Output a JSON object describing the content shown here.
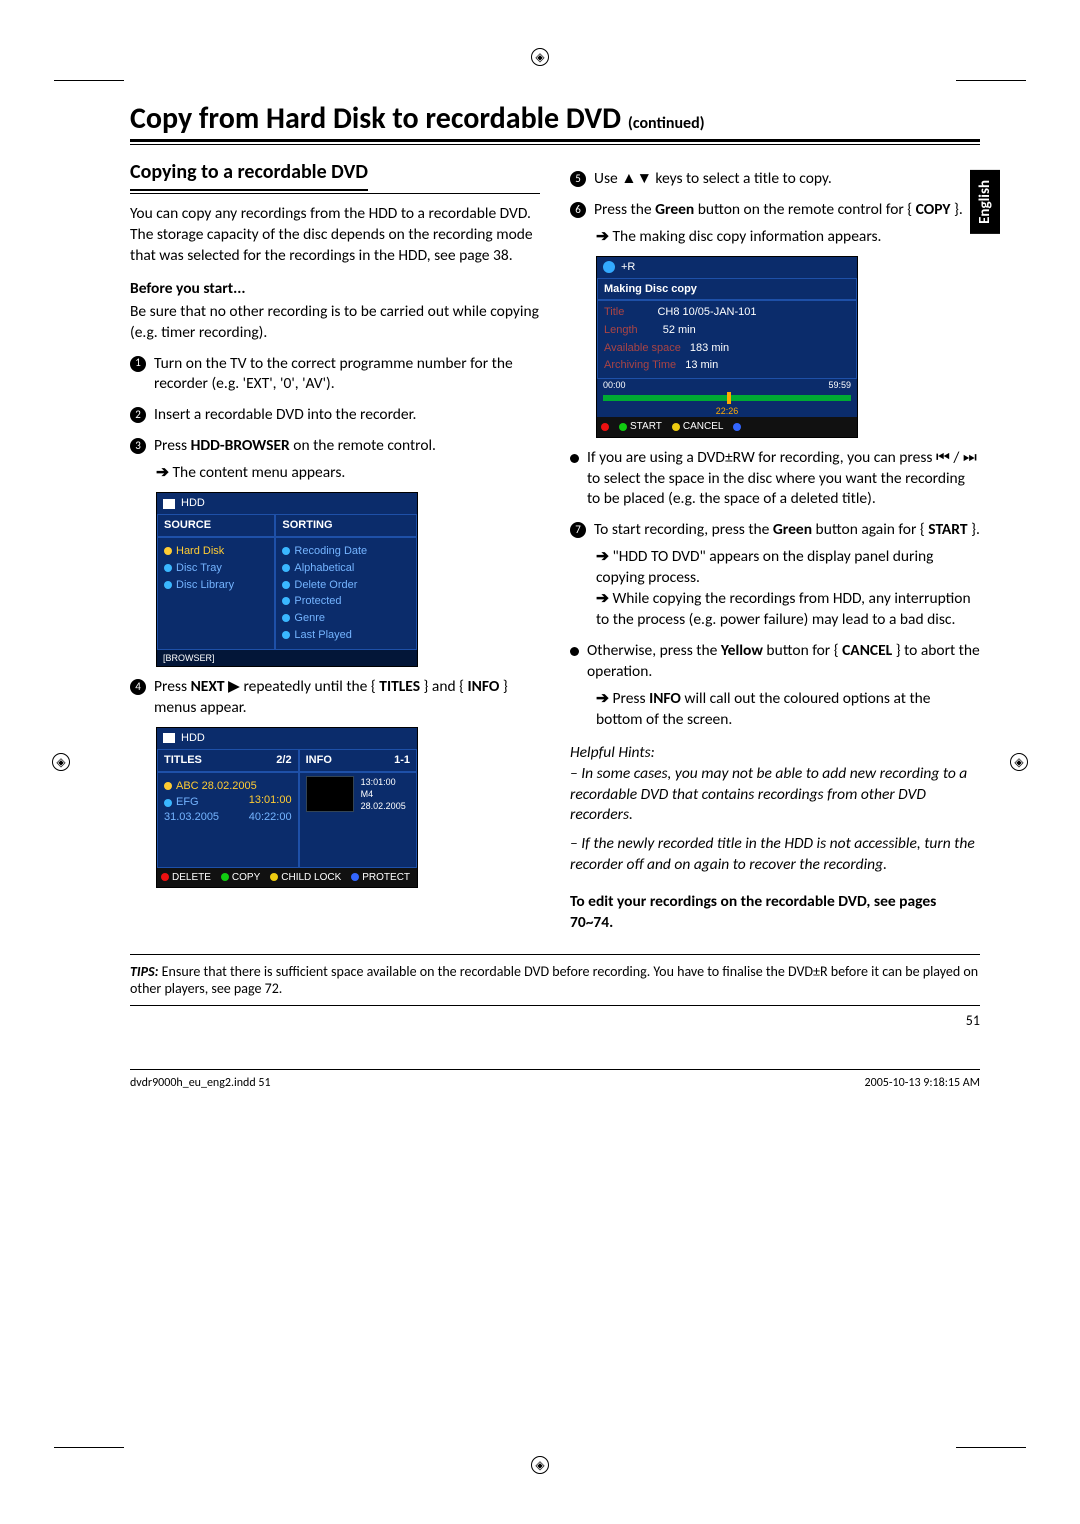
{
  "title_main": "Copy from Hard Disk to recordable DVD",
  "title_cont": "(continued)",
  "lang_tab": "English",
  "section_heading": "Copying to a recordable DVD",
  "intro": "You can copy any recordings from the HDD to a recordable DVD. The storage capacity of the disc depends on the recording mode that was selected for the recordings in the HDD, see page 38.",
  "before_head": "Before you start...",
  "before_body": "Be sure that no other recording is to be carried out while copying (e.g. timer recording).",
  "steps_left": {
    "s1": "Turn on the TV to the correct programme number for the recorder (e.g. 'EXT', '0', 'AV').",
    "s2": "Insert a recordable DVD into the recorder.",
    "s3_a": "Press ",
    "s3_btn": "HDD-BROWSER",
    "s3_b": " on the remote control.",
    "s3_res": "The content menu appears.",
    "s4_a": "Press ",
    "s4_btn": "NEXT",
    "s4_icon": " ▶ ",
    "s4_b": "repeatedly until the { ",
    "s4_m1": "TITLES",
    "s4_c": " } and { ",
    "s4_m2": "INFO",
    "s4_d": " } menus appear."
  },
  "osd1": {
    "head": "HDD",
    "col1": "SOURCE",
    "col2": "SORTING",
    "src": [
      "Hard Disk",
      "Disc Tray",
      "Disc Library"
    ],
    "sort": [
      "Recoding Date",
      "Alphabetical",
      "Delete Order",
      "Protected",
      "Genre",
      "Last Played"
    ],
    "footer": "[BROWSER]"
  },
  "osd2": {
    "head": "HDD",
    "titles_h": "TITLES",
    "titles_pg": "2/2",
    "info_h": "INFO",
    "info_pg": "1-1",
    "rows": [
      {
        "name": "ABC 28.02.2005",
        "dur": "13:01:00"
      },
      {
        "name": "EFG 31.03.2005",
        "dur": "40:22:00"
      }
    ],
    "info_time": "13:01:00",
    "info_mode": "M4",
    "info_date": "28.02.2005",
    "bar": {
      "delete": "DELETE",
      "copy": "COPY",
      "child": "CHILD LOCK",
      "protect": "PROTECT"
    }
  },
  "steps_right": {
    "s5": "Use ▲▼ keys to select a title to copy.",
    "s6_a": "Press the ",
    "s6_btn": "Green",
    "s6_b": " button on the remote control for { ",
    "s6_m": "COPY",
    "s6_c": " }.",
    "s6_res": "The making disc copy information appears.",
    "bullet1": "If you are using a DVD±RW for recording, you can press ⏮ / ⏭ to select the space in the disc where you want the recording to be placed (e.g. the space of a deleted title).",
    "s7_a": "To start recording, press the ",
    "s7_btn": "Green",
    "s7_b": " button again for { ",
    "s7_m": "START",
    "s7_c": " }.",
    "s7_res1": "\"HDD TO DVD\" appears on the display panel during copying process.",
    "s7_res2": "While copying the recordings from HDD, any interruption to the process (e.g. power failure) may lead to a bad disc.",
    "bullet2_a": "Otherwise, press the ",
    "bullet2_btn": "Yellow",
    "bullet2_b": " button for { ",
    "bullet2_m": "CANCEL",
    "bullet2_c": " } to abort the operation.",
    "bullet2_res_a": "Press ",
    "bullet2_res_btn": "INFO",
    "bullet2_res_b": " will call out the coloured options at the bottom of the screen."
  },
  "osd3": {
    "head": "+R",
    "title": "Making Disc copy",
    "fields": {
      "Title": "CH8 10/05-JAN-101",
      "Length": "52 min",
      "Available space": "183 min",
      "Archiving Time": "13 min"
    },
    "left_t": "00:00",
    "right_t": "59:59",
    "mid_t": "22:26",
    "bar": {
      "start": "START",
      "cancel": "CANCEL"
    }
  },
  "hints_head": "Helpful Hints:",
  "hint1": "– In some cases, you may not be able to add new recording to a recordable DVD that contains recordings from other DVD recorders.",
  "hint2": "– If the newly recorded title in the HDD is not accessible, turn the recorder off and on again to recover the recording.",
  "edit_note": "To edit your recordings on the recordable DVD, see pages 70~74.",
  "tips_label": "TIPS:",
  "tips_body": "Ensure that there is sufficient space available on the recordable DVD before recording. You have to finalise the DVD±R before it can be played on other players, see page 72.",
  "page_num": "51",
  "footer_left": "dvdr9000h_eu_eng2.indd   51",
  "footer_right": "2005-10-13   9:18:15 AM"
}
